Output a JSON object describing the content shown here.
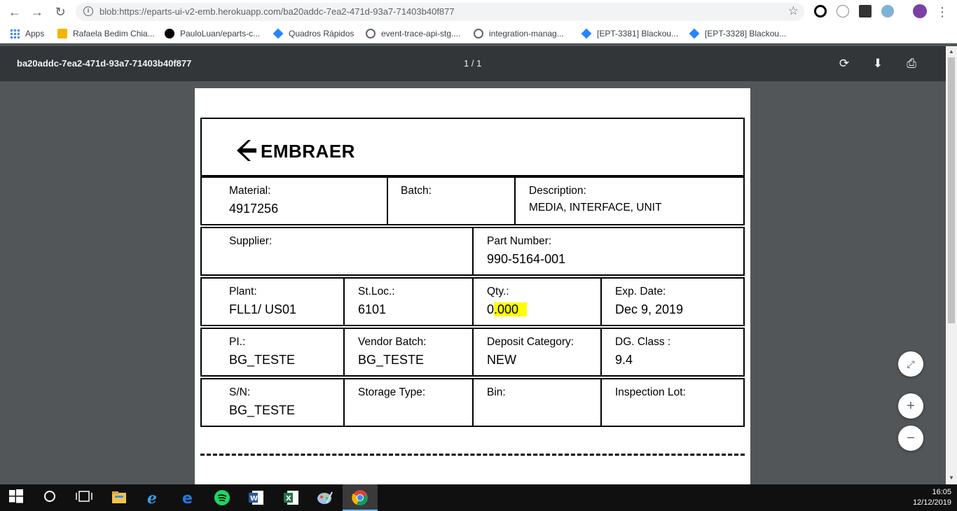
{
  "browser": {
    "url": "blob:https://eparts-ui-v2-emb.herokuapp.com/ba20addc-7ea2-471d-93a7-71403b40f877"
  },
  "bookmarks": [
    {
      "label": "Apps",
      "icon": "apps-grid-icon"
    },
    {
      "label": "Rafaela Bedim Chia...",
      "icon": "bookmark-favicon"
    },
    {
      "label": "PauloLuan/eparts-c...",
      "icon": "github-icon"
    },
    {
      "label": "Quadros Rápidos",
      "icon": "jira-icon"
    },
    {
      "label": "event-trace-api-stg....",
      "icon": "globe-icon"
    },
    {
      "label": "integration-manag...",
      "icon": "globe-icon"
    },
    {
      "label": "[EPT-3381] Blackou...",
      "icon": "jira-icon"
    },
    {
      "label": "[EPT-3328] Blackou...",
      "icon": "jira-icon"
    }
  ],
  "pdf": {
    "title": "ba20addc-7ea2-471d-93a7-71403b40f877",
    "page_indicator": "1 / 1"
  },
  "document": {
    "brand": "EMBRAER",
    "material_label": "Material:",
    "material_value": "4917256",
    "batch_label": "Batch:",
    "batch_value": "",
    "description_label": "Description:",
    "description_value": "MEDIA, INTERFACE, UNIT",
    "supplier_label": "Supplier:",
    "supplier_value": "",
    "part_number_label": "Part Number:",
    "part_number_value": "990-5164-001",
    "plant_label": "Plant:",
    "plant_value": "FLL1/ US01",
    "stloc_label": "St.Loc.:",
    "stloc_value": "6101",
    "qty_label": "Qty.:",
    "qty_value_prefix": "0",
    "qty_value_highlight": ".000",
    "exp_date_label": "Exp. Date:",
    "exp_date_value": "Dec 9, 2019",
    "pi_label": "PI.:",
    "pi_value": "BG_TESTE",
    "vendor_batch_label": "Vendor Batch:",
    "vendor_batch_value": "BG_TESTE",
    "deposit_category_label": "Deposit Category:",
    "deposit_category_value": "NEW",
    "dg_class_label": "DG. Class :",
    "dg_class_value": "9.4",
    "sn_label": "S/N:",
    "sn_value": "BG_TESTE",
    "storage_type_label": "Storage Type:",
    "storage_type_value": "",
    "bin_label": "Bin:",
    "bin_value": "",
    "inspection_lot_label": "Inspection Lot:",
    "inspection_lot_value": ""
  },
  "taskbar": {
    "time": "16:05",
    "date": "12/12/2019"
  },
  "colors": {
    "highlight": "#ffff00",
    "pdf_toolbar": "#323639",
    "viewer_bg": "#525659"
  }
}
